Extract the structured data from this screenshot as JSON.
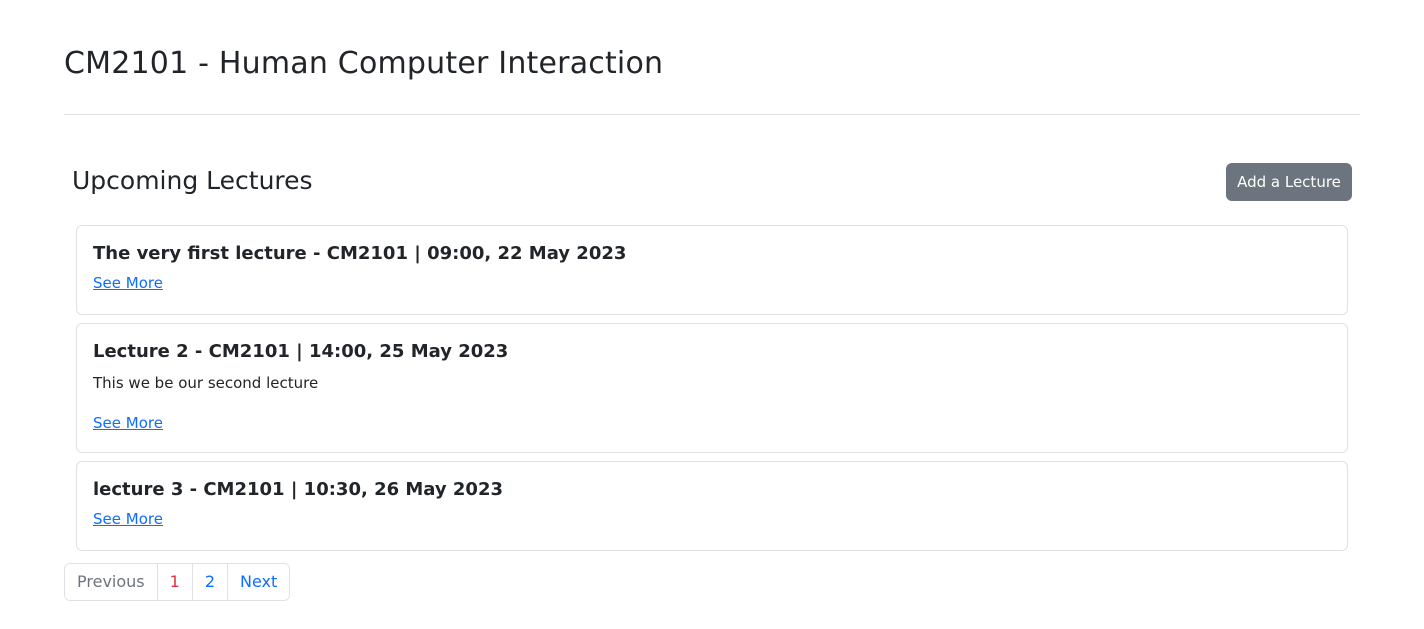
{
  "course": {
    "title": "CM2101 - Human Computer Interaction"
  },
  "section": {
    "title": "Upcoming Lectures",
    "add_button_label": "Add a Lecture"
  },
  "lectures": [
    {
      "title": "The very first lecture - CM2101 | 09:00, 22 May 2023",
      "description": "",
      "link_label": "See More"
    },
    {
      "title": "Lecture 2 - CM2101 | 14:00, 25 May 2023",
      "description": "This we be our second lecture",
      "link_label": "See More"
    },
    {
      "title": "lecture 3 - CM2101 | 10:30, 26 May 2023",
      "description": "",
      "link_label": "See More"
    }
  ],
  "pagination": {
    "previous_label": "Previous",
    "pages": [
      "1",
      "2"
    ],
    "current_page": "1",
    "next_label": "Next"
  },
  "colors": {
    "link": "#0d6efd",
    "current_page": "#dc3545",
    "button_bg": "#6c757d",
    "border": "#dee2e6",
    "text": "#212529"
  }
}
